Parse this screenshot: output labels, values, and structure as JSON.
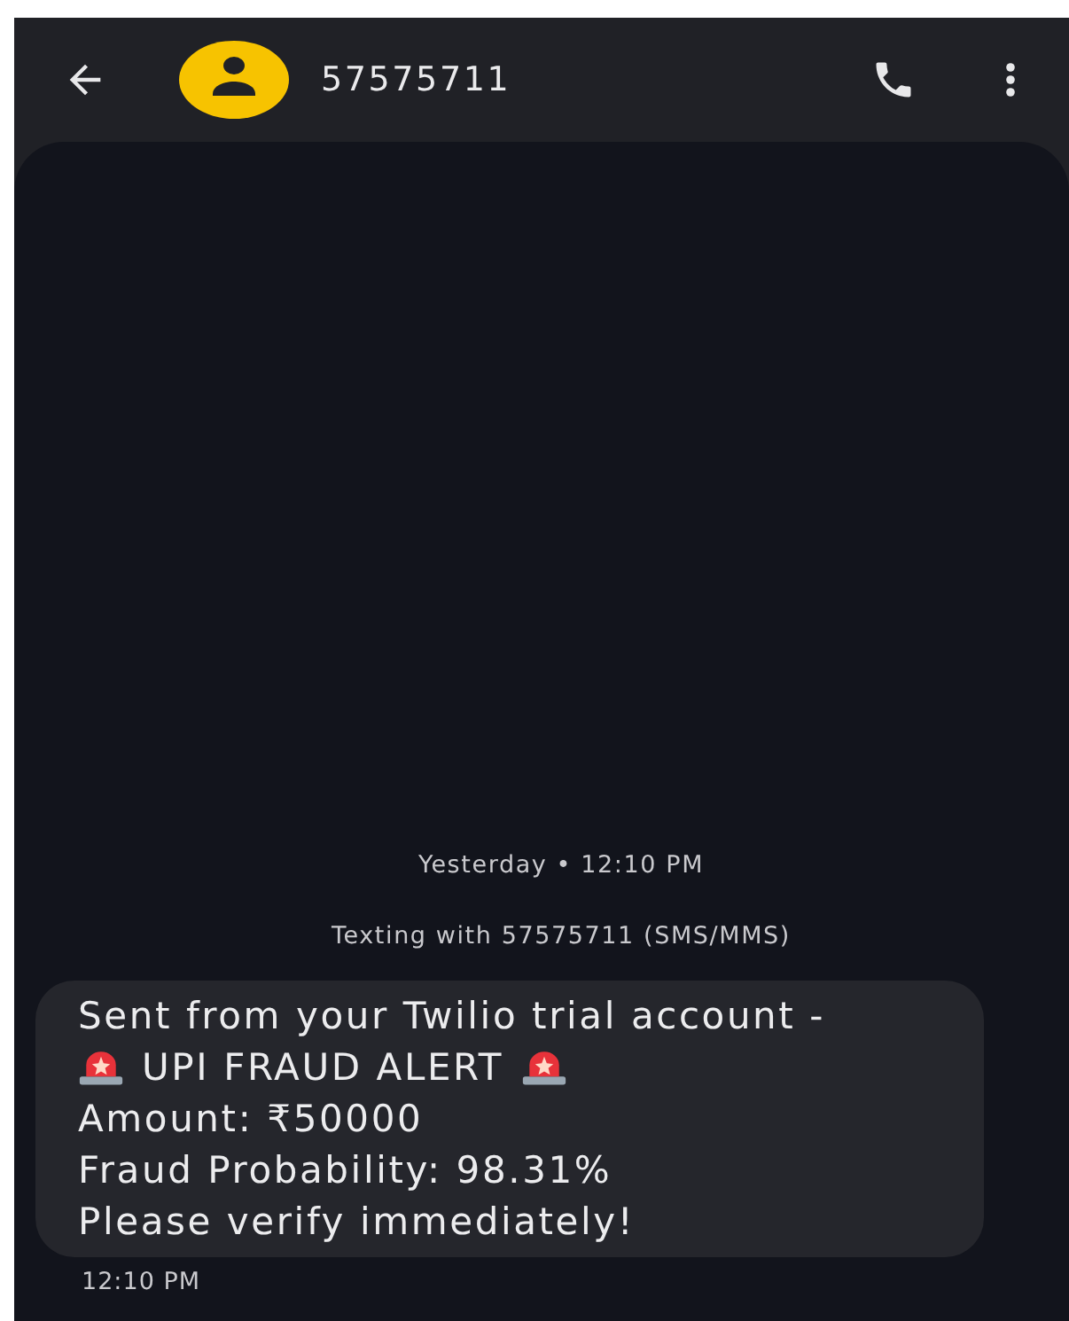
{
  "header": {
    "contact": "57575711"
  },
  "conversation": {
    "date_divider": "Yesterday • 12:10 PM",
    "info": "Texting with 57575711 (SMS/MMS)",
    "messages": [
      {
        "lines": [
          {
            "parts": [
              {
                "kind": "text",
                "text": "Sent from your Twilio trial account -"
              }
            ]
          },
          {
            "parts": [
              {
                "kind": "siren"
              },
              {
                "kind": "text",
                "text": "UPI FRAUD ALERT"
              },
              {
                "kind": "siren"
              }
            ]
          },
          {
            "parts": [
              {
                "kind": "text",
                "text": "Amount: ₹50000"
              }
            ]
          },
          {
            "parts": [
              {
                "kind": "text",
                "text": "Fraud Probability: 98.31%"
              }
            ]
          },
          {
            "parts": [
              {
                "kind": "text",
                "text": "Please verify immediately!"
              }
            ]
          }
        ],
        "time": "12:10 PM"
      }
    ]
  }
}
